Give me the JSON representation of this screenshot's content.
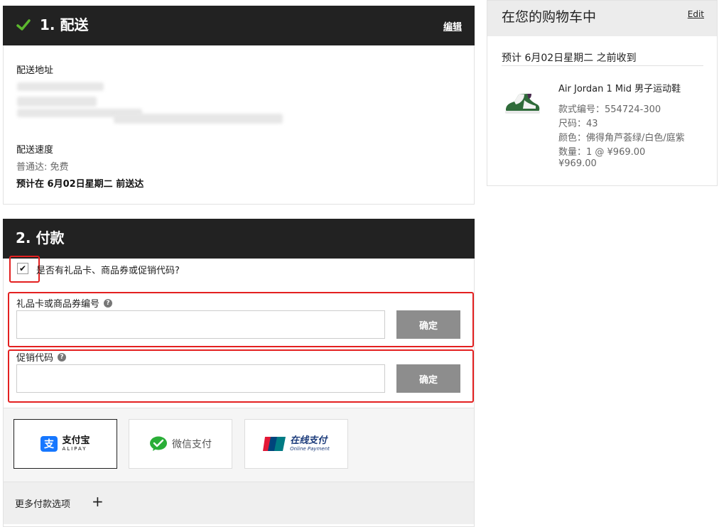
{
  "shipping": {
    "title": "1. 配送",
    "edit_label": "编辑",
    "address_label": "配送地址",
    "speed_label": "配送速度",
    "speed_value": "普通达: 免费",
    "estimate": "预计在 6月02日星期二 前送达"
  },
  "payment": {
    "title": "2. 付款",
    "gift_checkbox_label": "是否有礼品卡、商品券或促销代码?",
    "gift_checked": true,
    "giftcard_label": "礼品卡或商品券编号",
    "giftcard_value": "",
    "promo_label": "促销代码",
    "promo_value": "",
    "confirm_label": "确定",
    "methods": [
      {
        "name": "alipay",
        "label": "支付宝",
        "sublabel": "ALIPAY",
        "selected": true
      },
      {
        "name": "wechat",
        "label": "微信支付",
        "selected": false
      },
      {
        "name": "unionpay",
        "label": "在线支付",
        "sublabel": "Online Payment",
        "badge": "UnionPay 银联",
        "selected": false
      }
    ],
    "more_label": "更多付款选项",
    "more_icon": "+"
  },
  "cart": {
    "title": "在您的购物车中",
    "edit_label": "Edit",
    "arrival": "预计 6月02日星期二 之前收到",
    "product": {
      "name": "Air Jordan 1 Mid 男子运动鞋",
      "style": "款式编号：554724-300",
      "size": "尺码：43",
      "color": "颜色：佛得角芦荟绿/白色/庭紫",
      "qty": "数量：1 @ ¥969.00",
      "price": "¥969.00"
    }
  },
  "colors": {
    "header_bg": "#222222",
    "check_green": "#5cb82e",
    "highlight_red": "#e32020",
    "button_gray": "#8d8d8d"
  }
}
